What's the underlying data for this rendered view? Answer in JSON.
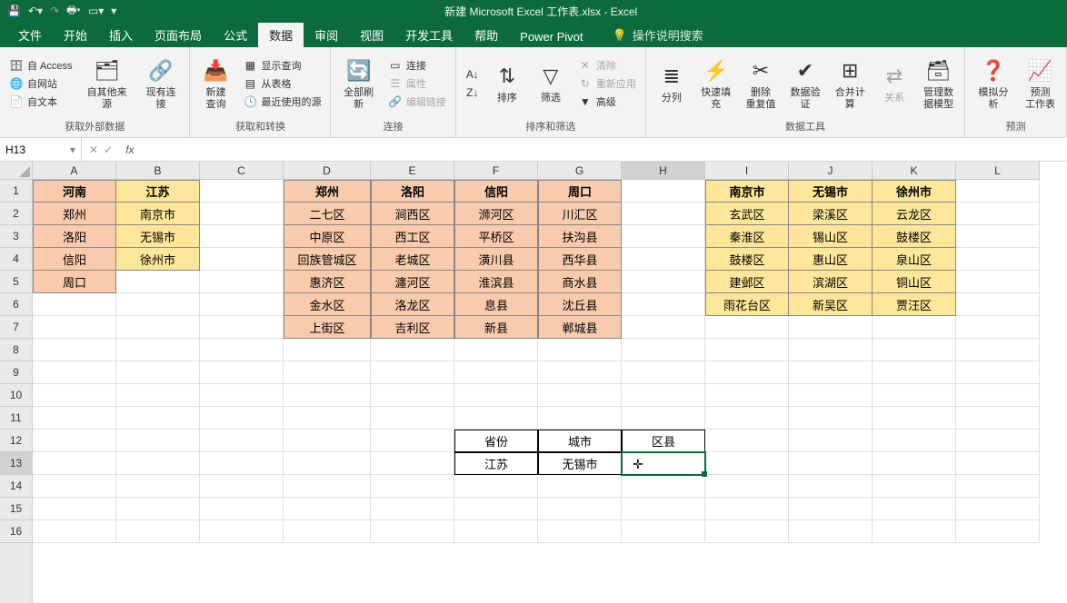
{
  "app": {
    "title": "新建 Microsoft Excel 工作表.xlsx  -  Excel"
  },
  "tabs": {
    "file": "文件",
    "home": "开始",
    "insert": "插入",
    "layout": "页面布局",
    "formulas": "公式",
    "data": "数据",
    "review": "审阅",
    "view": "视图",
    "dev": "开发工具",
    "help": "帮助",
    "powerpivot": "Power Pivot",
    "tellme": "操作说明搜索"
  },
  "ribbon": {
    "ext": {
      "access": "自 Access",
      "web": "自网站",
      "text": "自文本",
      "other": "自其他来源",
      "existing": "现有连接",
      "group": "获取外部数据"
    },
    "get": {
      "newquery": "新建\n查询",
      "show": "显示查询",
      "table": "从表格",
      "recent": "最近使用的源",
      "group": "获取和转换"
    },
    "conn": {
      "refresh": "全部刷新",
      "connections": "连接",
      "properties": "属性",
      "editlinks": "编辑链接",
      "group": "连接"
    },
    "sort": {
      "az": "A→Z",
      "za": "Z→A",
      "sort": "排序",
      "filter": "筛选",
      "clear": "清除",
      "reapply": "重新应用",
      "advanced": "高级",
      "group": "排序和筛选"
    },
    "tools": {
      "texttocol": "分列",
      "flash": "快速填充",
      "dup": "删除\n重复值",
      "valid": "数据验\n证",
      "consol": "合并计算",
      "rel": "关系",
      "model": "管理数\n据模型",
      "group": "数据工具"
    },
    "forecast": {
      "whatif": "模拟分析",
      "sheet": "预测\n工作表",
      "group": "预测"
    }
  },
  "namebox": {
    "ref": "H13"
  },
  "cols": [
    "A",
    "B",
    "C",
    "D",
    "E",
    "F",
    "G",
    "H",
    "I",
    "J",
    "K",
    "L"
  ],
  "rows": [
    "1",
    "2",
    "3",
    "4",
    "5",
    "6",
    "7",
    "8",
    "9",
    "10",
    "11",
    "12",
    "13",
    "14",
    "15",
    "16"
  ],
  "sheet": {
    "A1": "河南",
    "B1": "江苏",
    "D1": "郑州",
    "E1": "洛阳",
    "F1": "信阳",
    "G1": "周口",
    "I1": "南京市",
    "J1": "无锡市",
    "K1": "徐州市",
    "A2": "郑州",
    "B2": "南京市",
    "D2": "二七区",
    "E2": "涧西区",
    "F2": "浉河区",
    "G2": "川汇区",
    "I2": "玄武区",
    "J2": "梁溪区",
    "K2": "云龙区",
    "A3": "洛阳",
    "B3": "无锡市",
    "D3": "中原区",
    "E3": "西工区",
    "F3": "平桥区",
    "G3": "扶沟县",
    "I3": "秦淮区",
    "J3": "锡山区",
    "K3": "鼓楼区",
    "A4": "信阳",
    "B4": "徐州市",
    "D4": "回族管城区",
    "E4": "老城区",
    "F4": "潢川县",
    "G4": "西华县",
    "I4": "鼓楼区",
    "J4": "惠山区",
    "K4": "泉山区",
    "A5": "周口",
    "D5": "惠济区",
    "E5": "瀍河区",
    "F5": "淮滨县",
    "G5": "商水县",
    "I5": "建邺区",
    "J5": "滨湖区",
    "K5": "铜山区",
    "D6": "金水区",
    "E6": "洛龙区",
    "F6": "息县",
    "G6": "沈丘县",
    "I6": "雨花台区",
    "J6": "新吴区",
    "K6": "贾汪区",
    "D7": "上街区",
    "E7": "吉利区",
    "F7": "新县",
    "G7": "郸城县",
    "F12": "省份",
    "G12": "城市",
    "H12": "区县",
    "F13": "江苏",
    "G13": "无锡市"
  },
  "colW": {
    "A": 92,
    "B": 92,
    "C": 92,
    "D": 96,
    "E": 92,
    "F": 92,
    "G": 92,
    "H": 92,
    "I": 92,
    "J": 92,
    "K": 92,
    "L": 92
  }
}
